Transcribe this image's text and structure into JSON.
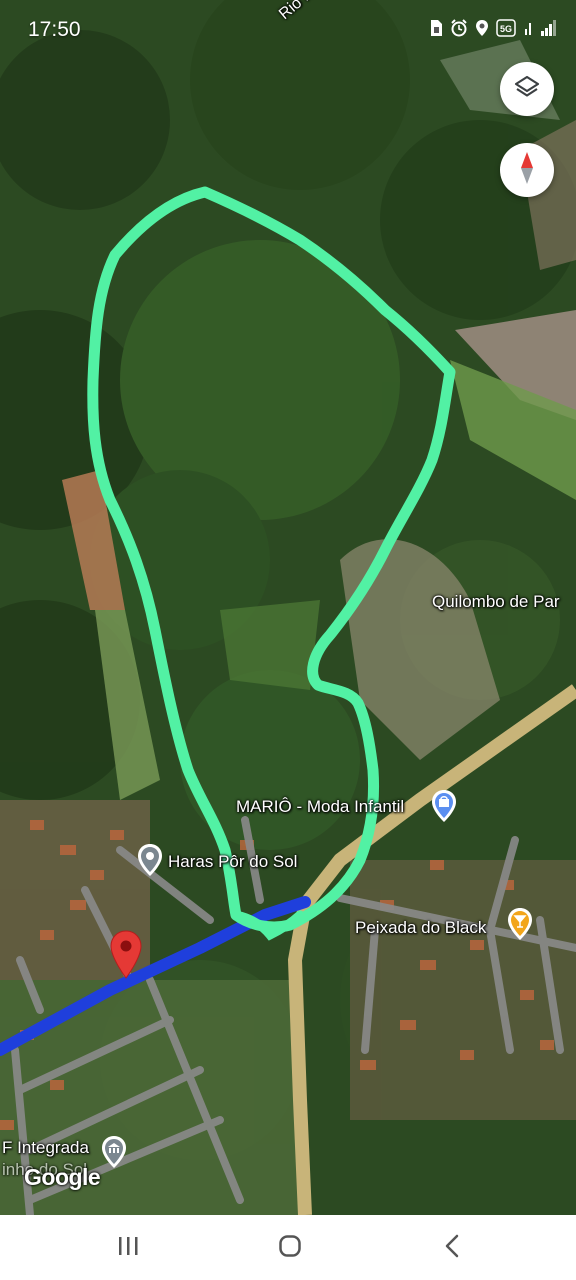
{
  "status_bar": {
    "time": "17:50",
    "icons": [
      "sim-card-icon",
      "alarm-icon",
      "location-icon",
      "5g-icon",
      "wifi-calling-icon",
      "signal-icon"
    ],
    "network_label": "5G"
  },
  "map": {
    "map_type": "satellite",
    "labels": {
      "river": "Rio Mangab",
      "quilombo": "Quilombo de Par",
      "mario": "MARIÔ - Moda Infantil",
      "haras": "Haras Pôr do Sol",
      "peixada": "Peixada do Black",
      "integrada": "F Integrada",
      "integrada_line2": "inho do Sol"
    },
    "attribution": "Google",
    "colors": {
      "drawn_path": "#52f1a4",
      "route": "#1f3fdc",
      "main_road": "#c8b479",
      "side_roads": "#8a8a8a",
      "pin": "#e53935",
      "place_icon": "#5b8ff0",
      "restaurant_icon": "#f2a51a"
    }
  },
  "controls": {
    "layers_button": "layers-icon",
    "compass_button": "compass-icon"
  },
  "nav_bar": {
    "items": [
      "recent-apps-icon",
      "home-icon",
      "back-icon"
    ]
  }
}
